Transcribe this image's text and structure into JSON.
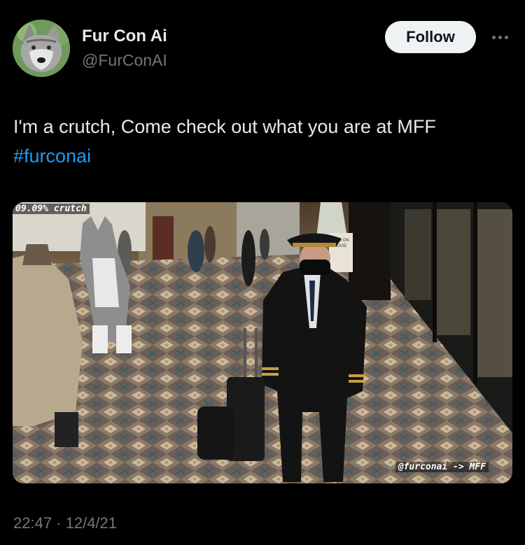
{
  "author": {
    "display_name": "Fur Con Ai",
    "handle": "@FurConAI",
    "avatar_icon": "wolf-avatar"
  },
  "actions": {
    "follow_label": "Follow",
    "more_icon": "more-horizontal-icon"
  },
  "tweet": {
    "text": "I'm a crutch, Come check out what you are at MFF",
    "hashtag": "#furconai"
  },
  "media": {
    "overlay_top_left": "09.09% crutch",
    "overlay_bottom_right": "@furconai -> MFF",
    "sign_text": "ASKS ON LEASE"
  },
  "meta": {
    "timestamp": "22:47 · 12/4/21"
  },
  "colors": {
    "background": "#000000",
    "text": "#e7e9ea",
    "secondary": "#71767b",
    "link": "#1d9bf0",
    "follow_bg": "#eff3f4"
  }
}
